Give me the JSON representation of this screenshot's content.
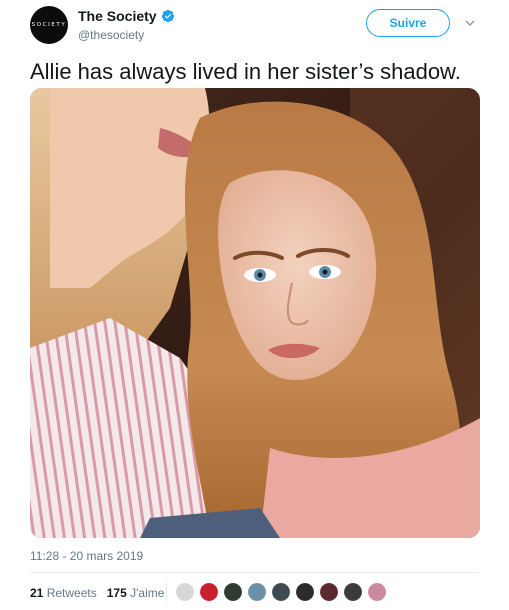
{
  "account": {
    "avatar_wordmark": "SOCIETY",
    "display_name": "The Society",
    "handle": "@thesociety",
    "verified_icon": "verified-badge-icon",
    "verified_color": "#1da1f2"
  },
  "follow_button": {
    "label": "Suivre",
    "color": "#1da1f2"
  },
  "menu_icon": "chevron-down-icon",
  "tweet": {
    "text": "Allie has always lived in her sister’s shadow.",
    "timestamp": "11:28 - 20 mars 2019"
  },
  "stats": {
    "retweets_count": "21",
    "retweets_label": "Retweets",
    "likes_count": "175",
    "likes_label": "J'aime"
  },
  "likers": [
    {
      "name": "liker-avatar-1",
      "color": "#d7d7d7"
    },
    {
      "name": "liker-avatar-2",
      "color": "#c8202e"
    },
    {
      "name": "liker-avatar-3",
      "color": "#2f3a34"
    },
    {
      "name": "liker-avatar-4",
      "color": "#6b8fa6"
    },
    {
      "name": "liker-avatar-5",
      "color": "#3d4a52"
    },
    {
      "name": "liker-avatar-6",
      "color": "#2c2c2c"
    },
    {
      "name": "liker-avatar-7",
      "color": "#5a2a2e"
    },
    {
      "name": "liker-avatar-8",
      "color": "#3b3b3b"
    },
    {
      "name": "liker-avatar-9",
      "color": "#c98aa0"
    }
  ]
}
